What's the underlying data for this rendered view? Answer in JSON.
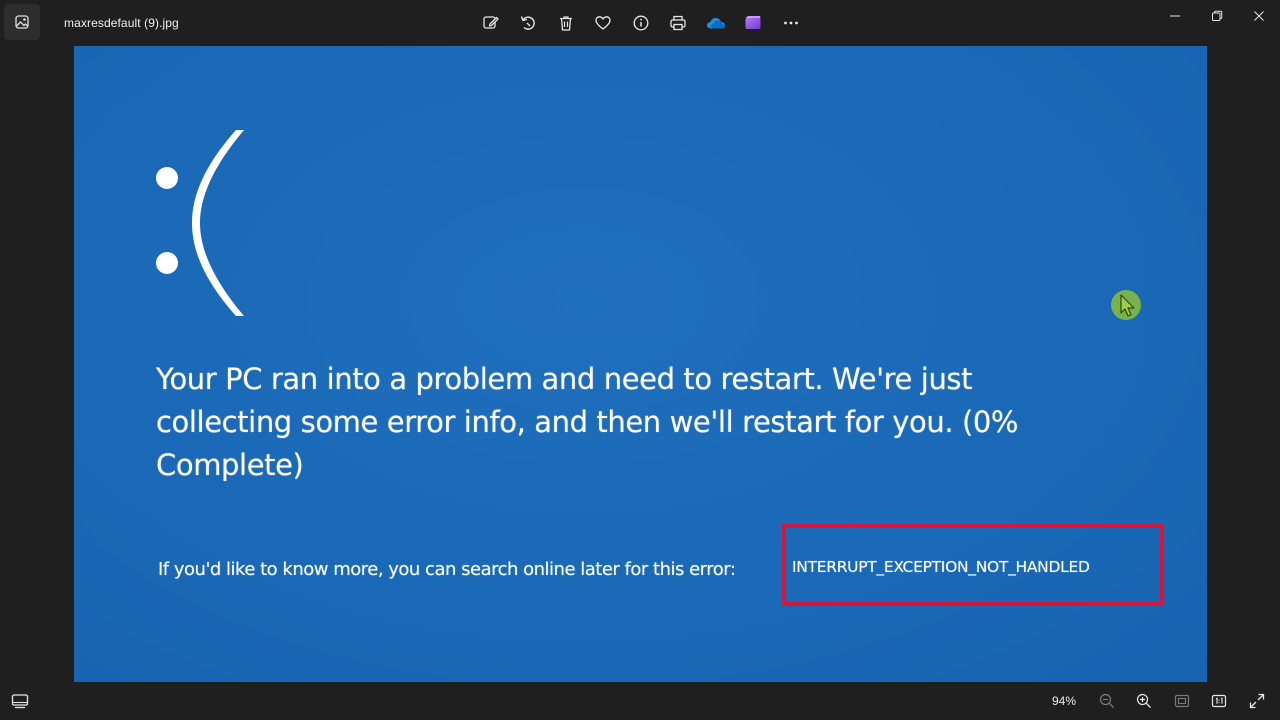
{
  "window": {
    "file_name": "maxresdefault (9).jpg"
  },
  "toolbar": {
    "items": [
      {
        "name": "edit-image-icon"
      },
      {
        "name": "rotate-icon"
      },
      {
        "name": "delete-icon"
      },
      {
        "name": "favorite-heart-icon"
      },
      {
        "name": "file-info-icon"
      },
      {
        "name": "print-icon"
      },
      {
        "name": "onedrive-cloud-icon"
      },
      {
        "name": "clipchamp-icon"
      },
      {
        "name": "more-options-icon"
      }
    ]
  },
  "image": {
    "sad_face": ":(",
    "message": "Your PC ran into a problem and need to restart. We're just collecting some error info, and then we'll restart for you. (0% Complete)",
    "info_prefix": "If you'd like to know more, you can search online later for this error:",
    "stop_code": "INTERRUPT_EXCEPTION_NOT_HANDLED"
  },
  "statusbar": {
    "zoom_level": "94%"
  },
  "colors": {
    "bsod_blue": "#1a68b6",
    "highlight_red": "#d3173a",
    "chrome_dark": "#1f1f1f",
    "cursor_green": "#8bbf3a"
  }
}
